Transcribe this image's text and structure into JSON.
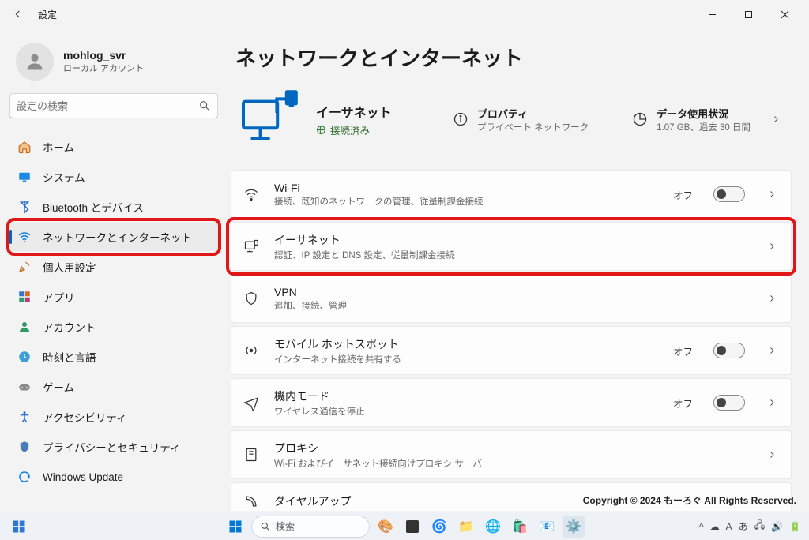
{
  "titlebar": {
    "app_name": "設定"
  },
  "account": {
    "name": "mohlog_svr",
    "subtitle": "ローカル アカウント"
  },
  "search": {
    "placeholder": "設定の検索"
  },
  "sidebar": {
    "items": [
      {
        "label": "ホーム",
        "icon": "home"
      },
      {
        "label": "システム",
        "icon": "system"
      },
      {
        "label": "Bluetooth とデバイス",
        "icon": "bluetooth"
      },
      {
        "label": "ネットワークとインターネット",
        "icon": "network",
        "selected": true
      },
      {
        "label": "個人用設定",
        "icon": "personalize"
      },
      {
        "label": "アプリ",
        "icon": "apps"
      },
      {
        "label": "アカウント",
        "icon": "account"
      },
      {
        "label": "時刻と言語",
        "icon": "time"
      },
      {
        "label": "ゲーム",
        "icon": "gaming"
      },
      {
        "label": "アクセシビリティ",
        "icon": "accessibility"
      },
      {
        "label": "プライバシーとセキュリティ",
        "icon": "privacy"
      },
      {
        "label": "Windows Update",
        "icon": "update"
      }
    ]
  },
  "page": {
    "title": "ネットワークとインターネット",
    "hero": {
      "connection_title": "イーサネット",
      "connection_status": "接続済み",
      "properties_label": "プロパティ",
      "properties_sub": "プライベート ネットワーク",
      "data_label": "データ使用状況",
      "data_sub": "1.07 GB、過去 30 日間"
    },
    "cards": [
      {
        "id": "wifi",
        "title": "Wi-Fi",
        "desc": "接続、既知のネットワークの管理、従量制課金接続",
        "toggle": "オフ",
        "icon": "wifi"
      },
      {
        "id": "ethernet",
        "title": "イーサネット",
        "desc": "認証、IP 設定と DNS 設定、従量制課金接続",
        "highlight": true,
        "icon": "ethernet"
      },
      {
        "id": "vpn",
        "title": "VPN",
        "desc": "追加、接続、管理",
        "icon": "vpn"
      },
      {
        "id": "hotspot",
        "title": "モバイル ホットスポット",
        "desc": "インターネット接続を共有する",
        "toggle": "オフ",
        "icon": "hotspot"
      },
      {
        "id": "airplane",
        "title": "機内モード",
        "desc": "ワイヤレス通信を停止",
        "toggle": "オフ",
        "icon": "airplane"
      },
      {
        "id": "proxy",
        "title": "プロキシ",
        "desc": "Wi-Fi およびイーサネット接続向けプロキシ サーバー",
        "icon": "proxy"
      },
      {
        "id": "dialup",
        "title": "ダイヤルアップ",
        "desc": "",
        "icon": "dialup",
        "cutoff": true
      }
    ]
  },
  "footer": {
    "copyright": "Copyright © 2024 もーろぐ All Rights Reserved."
  },
  "taskbar": {
    "search_label": "検索"
  }
}
